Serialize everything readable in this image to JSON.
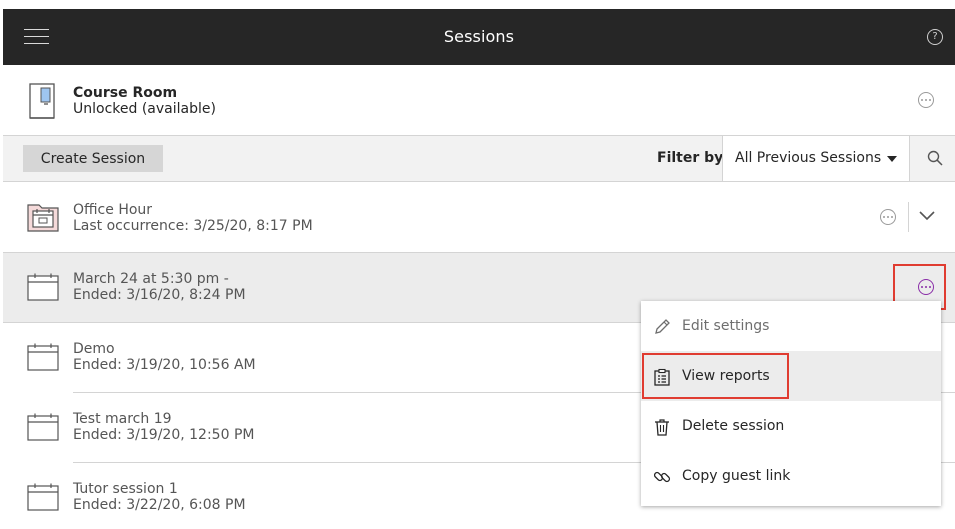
{
  "header": {
    "title": "Sessions",
    "menu_icon": "hamburger-icon",
    "help_icon": "help-icon",
    "help_symbol": "?"
  },
  "course_room": {
    "name": "Course Room",
    "status": "Unlocked (available)",
    "icon": "door-icon"
  },
  "toolbar": {
    "create_label": "Create Session",
    "filter_label": "Filter by",
    "filter_value": "All Previous Sessions",
    "search_icon": "search-icon"
  },
  "sessions": [
    {
      "name": "Office Hour",
      "detail": "Last occurrence: 3/25/20, 8:17 PM",
      "icon": "recurring-calendar-icon"
    },
    {
      "name": "March 24 at 5:30 pm -",
      "detail": "Ended: 3/16/20, 8:24 PM",
      "icon": "calendar-icon"
    },
    {
      "name": "Demo",
      "detail": "Ended: 3/19/20, 10:56 AM",
      "icon": "calendar-icon"
    },
    {
      "name": "Test march 19",
      "detail": "Ended: 3/19/20, 12:50 PM",
      "icon": "calendar-icon"
    },
    {
      "name": "Tutor session 1",
      "detail": "Ended: 3/22/20, 6:08 PM",
      "icon": "calendar-icon"
    }
  ],
  "menu": {
    "items": [
      {
        "label": "Edit settings",
        "icon": "pencil-icon",
        "disabled": true
      },
      {
        "label": "View reports",
        "icon": "report-icon",
        "active": true
      },
      {
        "label": "Delete session",
        "icon": "trash-icon"
      },
      {
        "label": "Copy guest link",
        "icon": "link-icon"
      }
    ]
  },
  "colors": {
    "header_bg": "#262626",
    "accent_purple": "#8a2ea8",
    "highlight_red": "#e03c31",
    "folder_pink": "#f5dada"
  }
}
